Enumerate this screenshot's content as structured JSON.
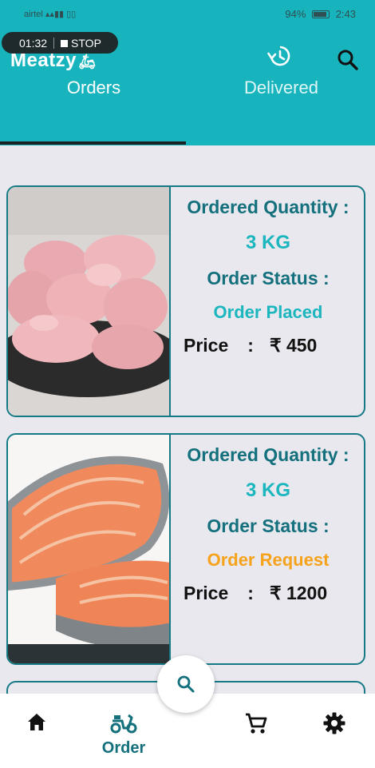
{
  "status_bar": {
    "carrier": "airtel",
    "battery": "94%",
    "time": "2:43"
  },
  "recording": {
    "timer": "01:32",
    "stop_label": "STOP"
  },
  "app": {
    "brand": "Meatzy",
    "accent_color": "#17b4bd",
    "dark_teal": "#13707c"
  },
  "tabs": [
    {
      "label": "Orders",
      "active": true
    },
    {
      "label": "Delivered",
      "active": false
    }
  ],
  "orders": [
    {
      "image": "raw-chicken-pieces",
      "quantity_label": "Ordered Quantity :",
      "quantity": "3 KG",
      "status_label": "Order Status :",
      "status": "Order Placed",
      "status_color": "#1bb6be",
      "price_label": "Price",
      "price_colon": ":",
      "price": "₹ 450"
    },
    {
      "image": "salmon-steaks",
      "quantity_label": "Ordered Quantity :",
      "quantity": "3 KG",
      "status_label": "Order Status :",
      "status": "Order Request",
      "status_color": "#f6a21a",
      "price_label": "Price",
      "price_colon": ":",
      "price": "₹ 1200"
    }
  ],
  "bottom_nav": {
    "items": [
      {
        "icon": "home-icon"
      },
      {
        "icon": "scooter-icon",
        "label": "Order"
      },
      {
        "icon": "cart-icon"
      },
      {
        "icon": "gear-icon"
      }
    ],
    "fab_icon": "search-icon"
  }
}
